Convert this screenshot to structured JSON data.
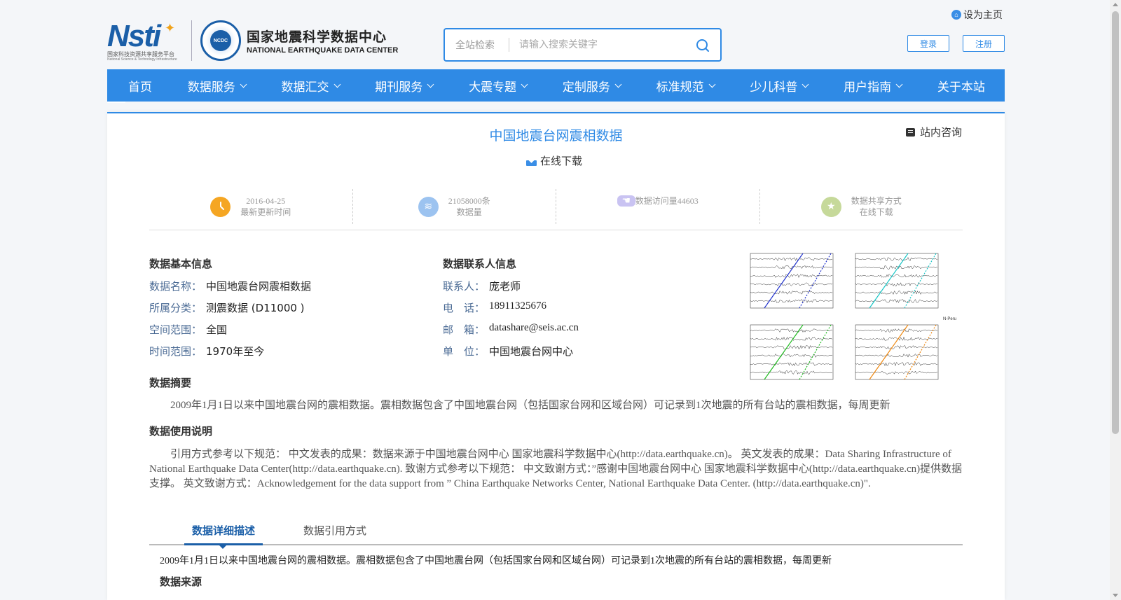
{
  "header": {
    "set_home": "设为主页",
    "logo": {
      "nsti_mark": "Nsti",
      "nsti_cn": "国家科技资源共享服务平台",
      "nsti_en": "National Science & Technology Infrastructure",
      "seal_text": "NCDC",
      "center_cn": "国家地震科学数据中心",
      "center_en": "NATIONAL EARTHQUAKE DATA CENTER"
    },
    "search": {
      "scope": "全站检索",
      "placeholder": "请输入搜索关键字"
    },
    "login": "登录",
    "register": "注册"
  },
  "nav": {
    "items": [
      {
        "label": "首页",
        "dropdown": false
      },
      {
        "label": "数据服务",
        "dropdown": true
      },
      {
        "label": "数据汇交",
        "dropdown": true
      },
      {
        "label": "期刊服务",
        "dropdown": true
      },
      {
        "label": "大震专题",
        "dropdown": true
      },
      {
        "label": "定制服务",
        "dropdown": true
      },
      {
        "label": "标准规范",
        "dropdown": true
      },
      {
        "label": "少儿科普",
        "dropdown": true
      },
      {
        "label": "用户指南",
        "dropdown": true
      },
      {
        "label": "关于本站",
        "dropdown": false
      }
    ]
  },
  "dataset": {
    "title": "中国地震台网震相数据",
    "consult": "站内咨询",
    "download": "在线下载",
    "stats": [
      {
        "value": "2016-04-25",
        "label": "最新更新时间",
        "icon": "clock-icon",
        "color": "#f5a623"
      },
      {
        "value": "21058000条",
        "label": "数据量",
        "icon": "layers-icon",
        "color": "#9cc3f0"
      },
      {
        "value": "数据访问量44603",
        "label": "",
        "icon": "hand-pointer-icon",
        "color": "#c9c3f2"
      },
      {
        "value": "数据共享方式",
        "label": "在线下载",
        "icon": "star-icon",
        "color": "#c6d99a"
      }
    ],
    "basic_info": {
      "heading": "数据基本信息",
      "rows": [
        {
          "key": "数据名称：",
          "value": "中国地震台网震相数据"
        },
        {
          "key": "所属分类：",
          "value": "测震数据 (D11000 )"
        },
        {
          "key": "空间范围：",
          "value": "全国"
        },
        {
          "key": "时间范围：",
          "value": "1970年至今"
        }
      ]
    },
    "contact_info": {
      "heading": "数据联系人信息",
      "rows": [
        {
          "key": "联系人：",
          "value": "庞老师"
        },
        {
          "key": "电　话：",
          "value": "18911325676"
        },
        {
          "key": "邮　箱：",
          "value": "datashare@seis.ac.cn"
        },
        {
          "key": "单　位：",
          "value": "中国地震台网中心"
        }
      ]
    },
    "summary": {
      "heading": "数据摘要",
      "text": "2009年1月1日以来中国地震台网的震相数据。震相数据包含了中国地震台网（包括国家台网和区域台网）可记录到1次地震的所有台站的震相数据，每周更新"
    },
    "usage": {
      "heading": "数据使用说明",
      "text": "引用方式参考以下规范： 中文发表的成果：数据来源于中国地震台网中心 国家地震科学数据中心(http://data.earthquake.cn)。 英文发表的成果：Data Sharing Infrastructure of National Earthquake Data Center(http://data.earthquake.cn). 致谢方式参考以下规范： 中文致谢方式：”感谢中国地震台网中心 国家地震科学数据中心(http://data.earthquake.cn)提供数据支撑。 英文致谢方式：Acknowledgement for the data support from ” China Earthquake Networks Center, National Earthquake Data Center. (http://data.earthquake.cn)\"."
    },
    "tabs": [
      "数据详细描述",
      "数据引用方式"
    ],
    "detail_text": "2009年1月1日以来中国地震台网的震相数据。震相数据包含了中国地震台网（包括国家台网和区域台网）可记录到1次地震的所有台站的震相数据，每周更新",
    "detail_heading": "数据来源",
    "figure_label": "N-Peru"
  }
}
